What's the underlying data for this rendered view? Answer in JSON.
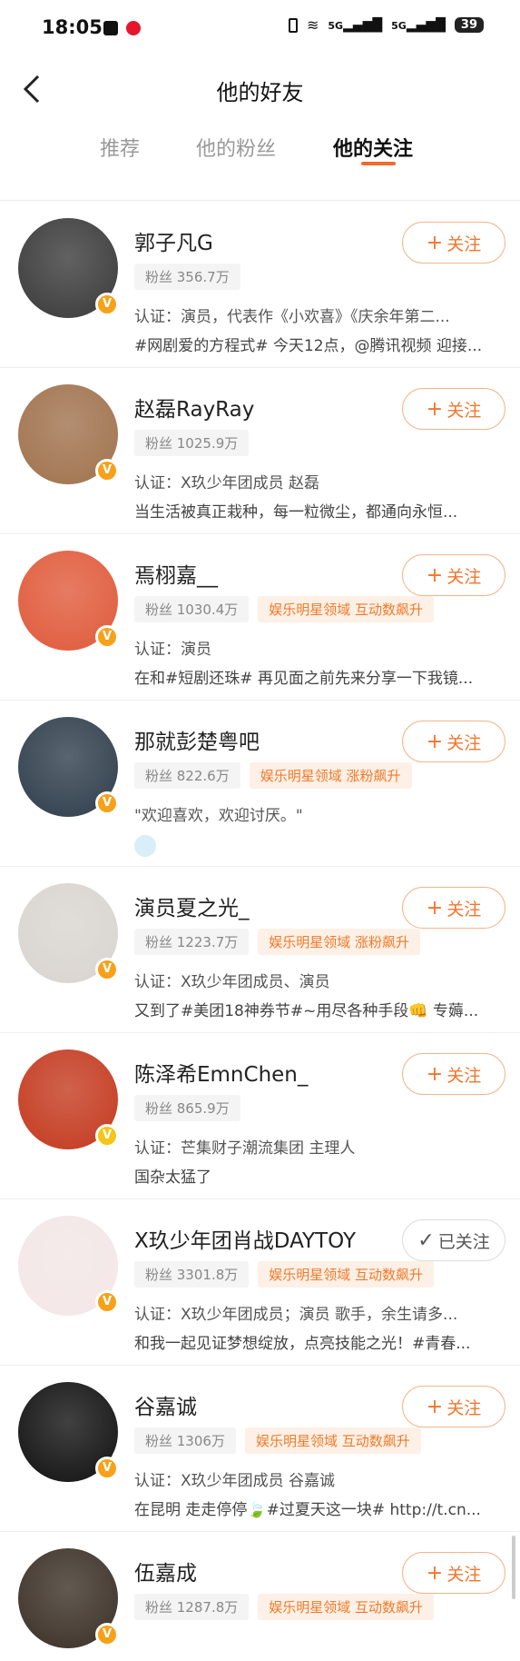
{
  "status": {
    "time": "18:05",
    "battery": "39",
    "signal_a": "5G",
    "signal_b": "5G"
  },
  "header": {
    "title": "他的好友"
  },
  "tabs": [
    "推荐",
    "他的粉丝",
    "他的关注"
  ],
  "users": [
    {
      "name": "郭子凡G",
      "fans": "粉丝 356.7万",
      "tags": [],
      "line1": "认证：演员，代表作《小欢喜》《庆余年第二...",
      "line2": "#网剧爱的方程式# 今天12点，@腾讯视频 迎接...",
      "button": "关注",
      "following": false,
      "avatar_color": "#3a3a3a",
      "badge": "orange"
    },
    {
      "name": "赵磊RayRay",
      "fans": "粉丝 1025.9万",
      "tags": [],
      "line1": "认证：X玖少年团成员 赵磊",
      "line2": "当生活被真正栽种，每一粒微尘，都通向永恒...",
      "button": "关注",
      "following": false,
      "avatar_color": "#a0724d",
      "badge": "orange"
    },
    {
      "name": "焉栩嘉__",
      "fans": "粉丝 1030.4万",
      "tags": [
        "娱乐明星领域 互动数飙升"
      ],
      "line1": "认证：演员",
      "line2": "在和#短剧还珠# 再见面之前先来分享一下我镜...",
      "button": "关注",
      "following": false,
      "avatar_color": "#e05a3a",
      "badge": "orange"
    },
    {
      "name": "那就彭楚粤吧",
      "fans": "粉丝 822.6万",
      "tags": [
        "娱乐明星领域 涨粉飙升"
      ],
      "line1": "\"欢迎喜欢，欢迎讨厌。\"",
      "line2": "",
      "button": "关注",
      "following": false,
      "avatar_color": "#2f3e4c",
      "badge": "orange"
    },
    {
      "name": "演员夏之光_",
      "fans": "粉丝 1223.7万",
      "tags": [
        "娱乐明星领域 涨粉飙升"
      ],
      "line1": "认证：X玖少年团成员、演员",
      "line2": "又到了#美团18神券节#~用尽各种手段👊 专薅...",
      "button": "关注",
      "following": false,
      "avatar_color": "#d9d4cf",
      "badge": "orange"
    },
    {
      "name": "陈泽希EmnChen_",
      "fans": "粉丝 865.9万",
      "tags": [],
      "line1": "认证：芒集财子潮流集团 主理人",
      "line2": "国杂太猛了",
      "button": "关注",
      "following": false,
      "avatar_color": "#c43a1f",
      "badge": "gold"
    },
    {
      "name": "X玖少年团肖战DAYTOY",
      "fans": "粉丝 3301.8万",
      "tags": [
        "娱乐明星领域 互动数飙升"
      ],
      "line1": "认证：X玖少年团成员；演员 歌手，余生请多...",
      "line2": "和我一起见证梦想绽放，点亮技能之光！#青春...",
      "button": "已关注",
      "following": true,
      "avatar_color": "#f3e6e6",
      "badge": "orange"
    },
    {
      "name": "谷嘉诚",
      "fans": "粉丝 1306万",
      "tags": [
        "娱乐明星领域 互动数飙升"
      ],
      "line1": "认证：X玖少年团成员 谷嘉诚",
      "line2": "在昆明 走走停停🍃#过夏天这一块# http://t.cn...",
      "button": "关注",
      "following": false,
      "avatar_color": "#111111",
      "badge": "orange"
    },
    {
      "name": "伍嘉成",
      "fans": "粉丝 1287.8万",
      "tags": [
        "娱乐明星领域 互动数飙升"
      ],
      "line1": "",
      "line2": "",
      "button": "关注",
      "following": false,
      "avatar_color": "#3b3026",
      "badge": "orange"
    }
  ],
  "colors": {
    "accent": "#f3752b",
    "tab_underline": "#f36a2b"
  }
}
